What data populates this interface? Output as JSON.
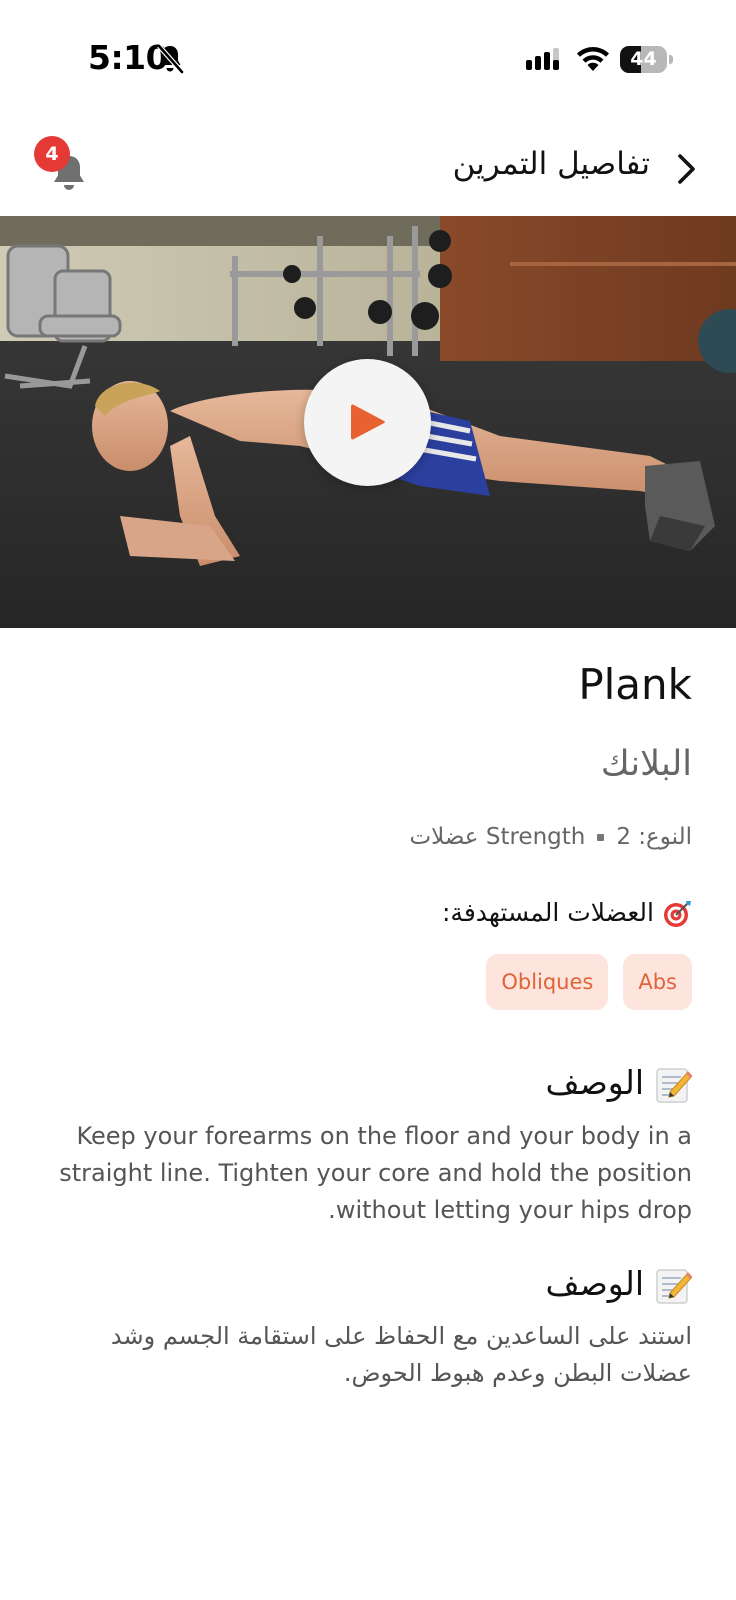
{
  "status_bar": {
    "time": "5:10",
    "battery_level": "44",
    "icons": [
      "bell-slash-icon",
      "signal-icon",
      "wifi-icon",
      "battery-icon"
    ]
  },
  "header": {
    "title": "تفاصيل التمرين",
    "notification_count": "4",
    "icons": [
      "bell-icon",
      "chevron-right-icon"
    ]
  },
  "video": {
    "play_icon": "play-icon"
  },
  "exercise": {
    "name_en": "Plank",
    "name_ar": "البلانك",
    "type_label": "النوع: Strength",
    "muscles_count": "2 عضلات"
  },
  "target_muscles": {
    "heading": "العضلات المستهدفة:",
    "icon": "target-icon",
    "tags": [
      "Abs",
      "Obliques"
    ]
  },
  "descriptions": [
    {
      "heading": "الوصف",
      "icon": "memo-icon",
      "text": "Keep your forearms on the floor and your body in a straight line. Tighten your core and hold the position without letting your hips drop."
    },
    {
      "heading": "الوصف",
      "icon": "memo-icon",
      "text": "استند على الساعدين مع الحفاظ على استقامة الجسم وشد عضلات البطن وعدم هبوط الحوض."
    }
  ],
  "colors": {
    "accent": "#e0633a",
    "tag_bg": "#fde4dc",
    "badge": "#e53935",
    "play": "#e8622f"
  }
}
